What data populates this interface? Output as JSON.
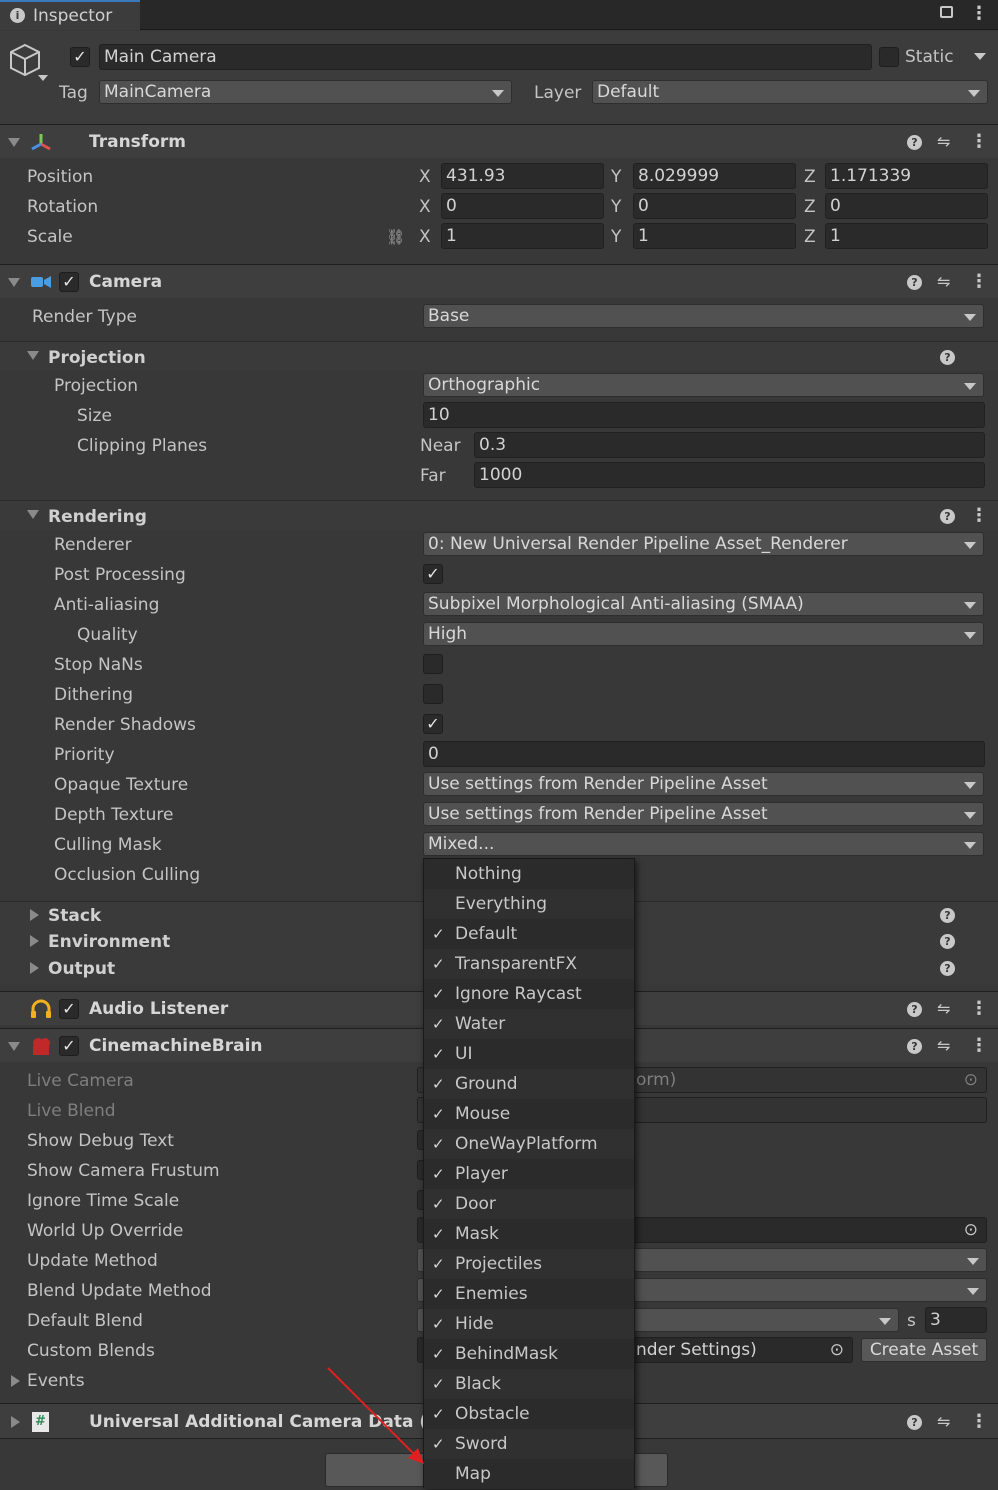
{
  "window": {
    "tab_title": "Inspector"
  },
  "object": {
    "name": "Main Camera",
    "active": true,
    "static_label": "Static",
    "tag_label": "Tag",
    "tag_value": "MainCamera",
    "layer_label": "Layer",
    "layer_value": "Default"
  },
  "transform": {
    "title": "Transform",
    "position": {
      "label": "Position",
      "x": "431.93",
      "y": "8.029999",
      "z": "1.171339"
    },
    "rotation": {
      "label": "Rotation",
      "x": "0",
      "y": "0",
      "z": "0"
    },
    "scale": {
      "label": "Scale",
      "x": "1",
      "y": "1",
      "z": "1"
    },
    "axis_x": "X",
    "axis_y": "Y",
    "axis_z": "Z"
  },
  "camera": {
    "title": "Camera",
    "render_type_label": "Render Type",
    "render_type": "Base",
    "projection_section": "Projection",
    "projection_label": "Projection",
    "projection": "Orthographic",
    "size_label": "Size",
    "size": "10",
    "clipping_label": "Clipping Planes",
    "near_label": "Near",
    "near": "0.3",
    "far_label": "Far",
    "far": "1000",
    "rendering_section": "Rendering",
    "renderer_label": "Renderer",
    "renderer": "0: New Universal Render Pipeline Asset_Renderer",
    "post_processing_label": "Post Processing",
    "post_processing": true,
    "anti_aliasing_label": "Anti-aliasing",
    "anti_aliasing": "Subpixel Morphological Anti-aliasing (SMAA)",
    "quality_label": "Quality",
    "quality": "High",
    "stop_nans_label": "Stop NaNs",
    "stop_nans": false,
    "dithering_label": "Dithering",
    "dithering": false,
    "render_shadows_label": "Render Shadows",
    "render_shadows": true,
    "priority_label": "Priority",
    "priority": "0",
    "opaque_texture_label": "Opaque Texture",
    "opaque_texture": "Use settings from Render Pipeline Asset",
    "depth_texture_label": "Depth Texture",
    "depth_texture": "Use settings from Render Pipeline Asset",
    "culling_mask_label": "Culling Mask",
    "culling_mask": "Mixed...",
    "occlusion_label": "Occlusion Culling",
    "stack_section": "Stack",
    "environment_section": "Environment",
    "output_section": "Output"
  },
  "audio_listener": {
    "title": "Audio Listener"
  },
  "cinemachine": {
    "title": "CinemachineBrain",
    "live_camera_label": "Live Camera",
    "live_camera_value": "orm)",
    "live_blend_label": "Live Blend",
    "show_debug_label": "Show Debug Text",
    "show_frustum_label": "Show Camera Frustum",
    "ignore_time_label": "Ignore Time Scale",
    "world_up_label": "World Up Override",
    "update_method_label": "Update Method",
    "blend_update_label": "Blend Update Method",
    "default_blend_label": "Default Blend",
    "default_blend_s": "s",
    "default_blend_time": "3",
    "custom_blends_label": "Custom Blends",
    "custom_blends_value": "nder Settings)",
    "create_asset": "Create Asset",
    "events_label": "Events"
  },
  "additional_data": {
    "title": "Universal Additional Camera Data (S"
  },
  "culling_menu": {
    "items": [
      {
        "label": "Nothing",
        "checked": false
      },
      {
        "label": "Everything",
        "checked": false
      },
      {
        "label": "Default",
        "checked": true
      },
      {
        "label": "TransparentFX",
        "checked": true
      },
      {
        "label": "Ignore Raycast",
        "checked": true
      },
      {
        "label": "Water",
        "checked": true
      },
      {
        "label": "UI",
        "checked": true
      },
      {
        "label": "Ground",
        "checked": true
      },
      {
        "label": "Mouse",
        "checked": true
      },
      {
        "label": "OneWayPlatform",
        "checked": true
      },
      {
        "label": "Player",
        "checked": true
      },
      {
        "label": "Door",
        "checked": true
      },
      {
        "label": "Mask",
        "checked": true
      },
      {
        "label": "Projectiles",
        "checked": true
      },
      {
        "label": "Enemies",
        "checked": true
      },
      {
        "label": "Hide",
        "checked": true
      },
      {
        "label": "BehindMask",
        "checked": true
      },
      {
        "label": "Black",
        "checked": true
      },
      {
        "label": "Obstacle",
        "checked": true
      },
      {
        "label": "Sword",
        "checked": true
      },
      {
        "label": "Map",
        "checked": false
      }
    ],
    "check_glyph": "✓"
  },
  "colors": {
    "annotation_arrow": "#e02020",
    "panel": "#383838",
    "header": "#3e3e3e"
  }
}
